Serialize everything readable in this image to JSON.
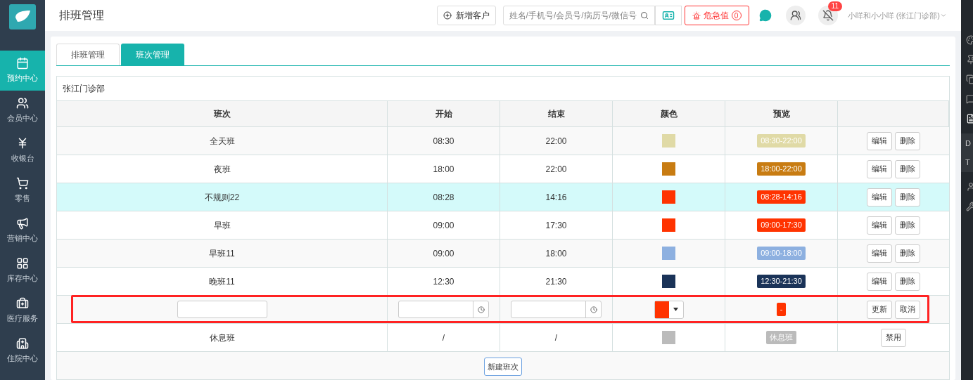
{
  "sidebar": {
    "items": [
      {
        "label": "预约中心",
        "selected": true
      },
      {
        "label": "会员中心",
        "selected": false
      },
      {
        "label": "收银台",
        "selected": false
      },
      {
        "label": "零售",
        "selected": false
      },
      {
        "label": "营销中心",
        "selected": false
      },
      {
        "label": "库存中心",
        "selected": false
      },
      {
        "label": "医疗服务",
        "selected": false
      },
      {
        "label": "住院中心",
        "selected": false
      }
    ]
  },
  "header": {
    "title": "排班管理",
    "add_button": "新增客户",
    "search": {
      "placeholder": "姓名/手机号/会员号/病历号/微信号"
    },
    "alert_button": "危急值",
    "alert_count": "0",
    "notification_count": "11",
    "user": "小咩和小小咩 (张江门诊部)"
  },
  "tabs": [
    {
      "label": "排班管理",
      "selected": false
    },
    {
      "label": "班次管理",
      "selected": true
    }
  ],
  "panel_title": "张江门诊部",
  "table": {
    "columns": [
      "班次",
      "开始",
      "结束",
      "颜色",
      "预览",
      ""
    ],
    "rows": [
      {
        "kind": "shift",
        "name": "全天班",
        "start": "08:30",
        "end": "22:00",
        "color": "#e0daa6",
        "preview": "08:30-22:00",
        "actions": [
          "编辑",
          "删除"
        ],
        "selected": false
      },
      {
        "kind": "shift",
        "name": "夜班",
        "start": "18:00",
        "end": "22:00",
        "color": "#c87c12",
        "preview": "18:00-22:00",
        "actions": [
          "编辑",
          "删除"
        ],
        "selected": false
      },
      {
        "kind": "shift",
        "name": "不规则22",
        "start": "08:28",
        "end": "14:16",
        "color": "#ff3300",
        "preview": "08:28-14:16",
        "actions": [
          "编辑",
          "删除"
        ],
        "selected": true
      },
      {
        "kind": "shift",
        "name": "早班",
        "start": "09:00",
        "end": "17:30",
        "color": "#ff3300",
        "preview": "09:00-17:30",
        "actions": [
          "编辑",
          "删除"
        ],
        "selected": false
      },
      {
        "kind": "shift",
        "name": "早班11",
        "start": "09:00",
        "end": "18:00",
        "color": "#8db0e0",
        "preview": "09:00-18:00",
        "actions": [
          "编辑",
          "删除"
        ],
        "selected": false
      },
      {
        "kind": "shift",
        "name": "晚班11",
        "start": "12:30",
        "end": "21:30",
        "color": "#1a3358",
        "preview": "12:30-21:30",
        "actions": [
          "编辑",
          "删除"
        ],
        "selected": false
      },
      {
        "kind": "edit",
        "color": "#ff3300",
        "preview": "-",
        "actions": [
          "更新",
          "取消"
        ],
        "selected": false
      },
      {
        "kind": "rest",
        "name": "休息班",
        "start": "/",
        "end": "/",
        "color": "#bbbbbb",
        "preview": "休息班",
        "actions": [
          "禁用"
        ],
        "selected": false
      }
    ]
  },
  "new_button": "新建班次",
  "side_window": {
    "items": [
      "D",
      "T"
    ]
  }
}
